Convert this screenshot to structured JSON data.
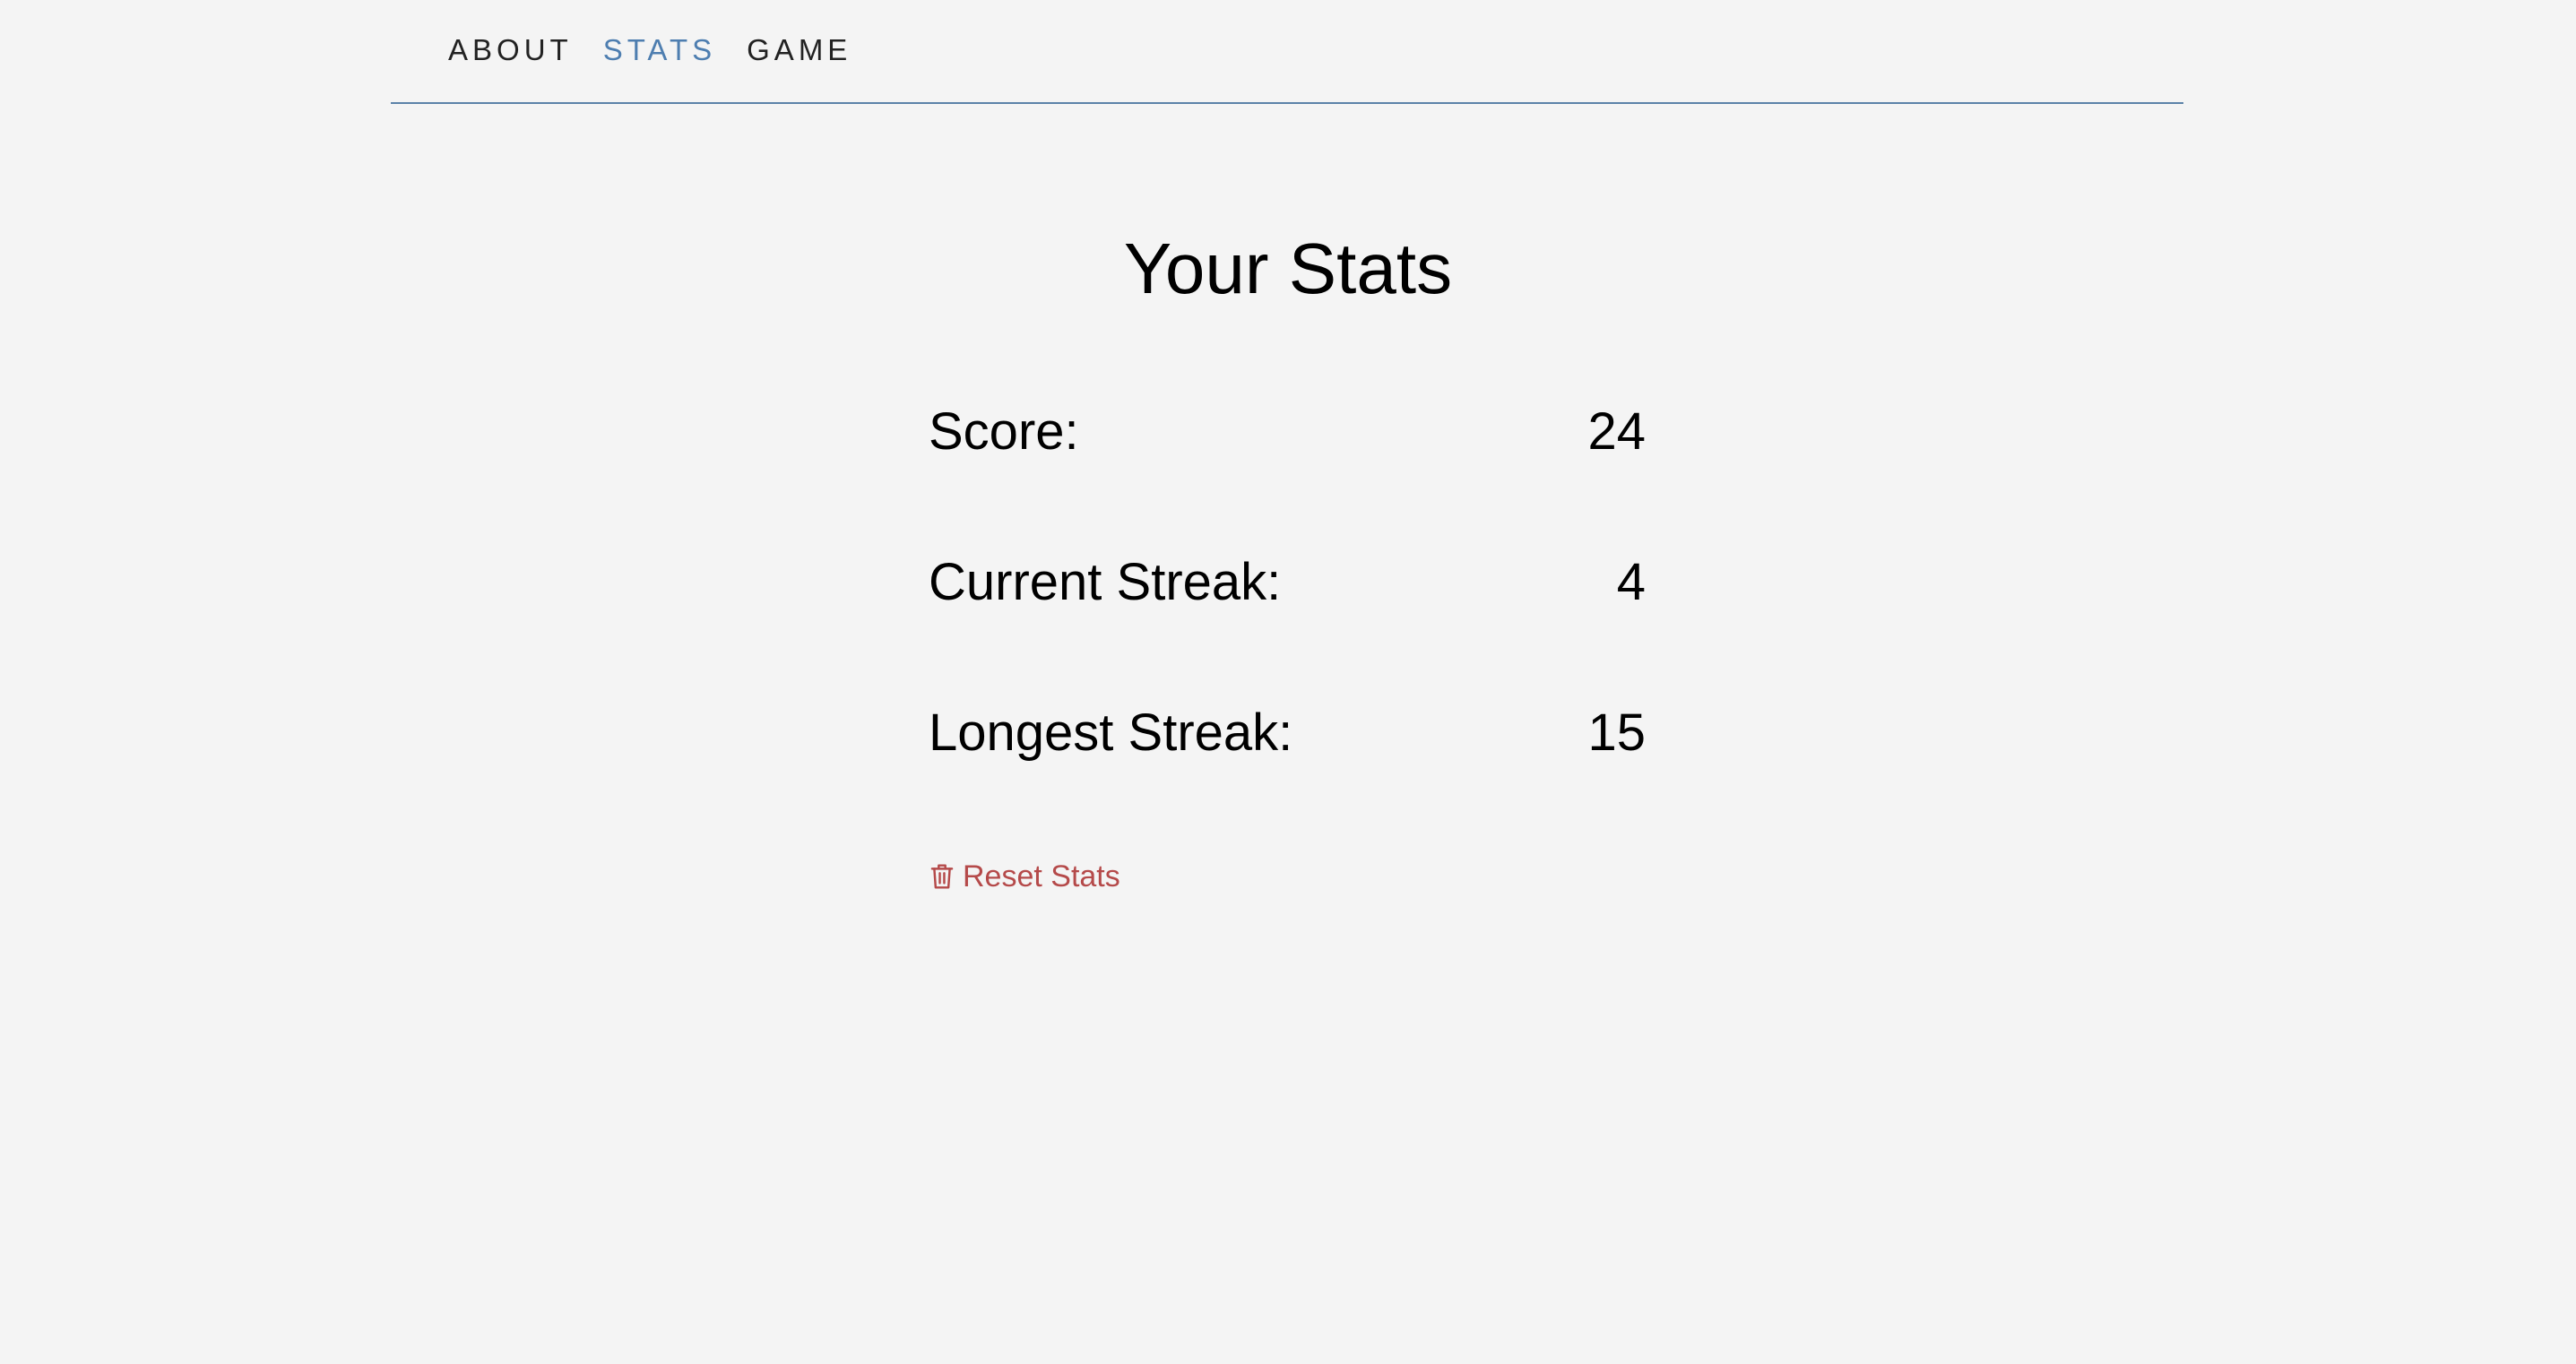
{
  "nav": {
    "items": [
      {
        "label": "ABOUT"
      },
      {
        "label": "STATS"
      },
      {
        "label": "GAME"
      }
    ]
  },
  "page": {
    "title": "Your Stats"
  },
  "stats": [
    {
      "label": "Score:",
      "value": "24"
    },
    {
      "label": "Current Streak:",
      "value": "4"
    },
    {
      "label": "Longest Streak:",
      "value": "15"
    }
  ],
  "reset": {
    "label": "Reset Stats",
    "icon": "trash-icon"
  },
  "colors": {
    "background": "#f4f4f4",
    "accent": "#4e7eb0",
    "danger": "#b54a4a",
    "divider": "#5b82a8"
  }
}
